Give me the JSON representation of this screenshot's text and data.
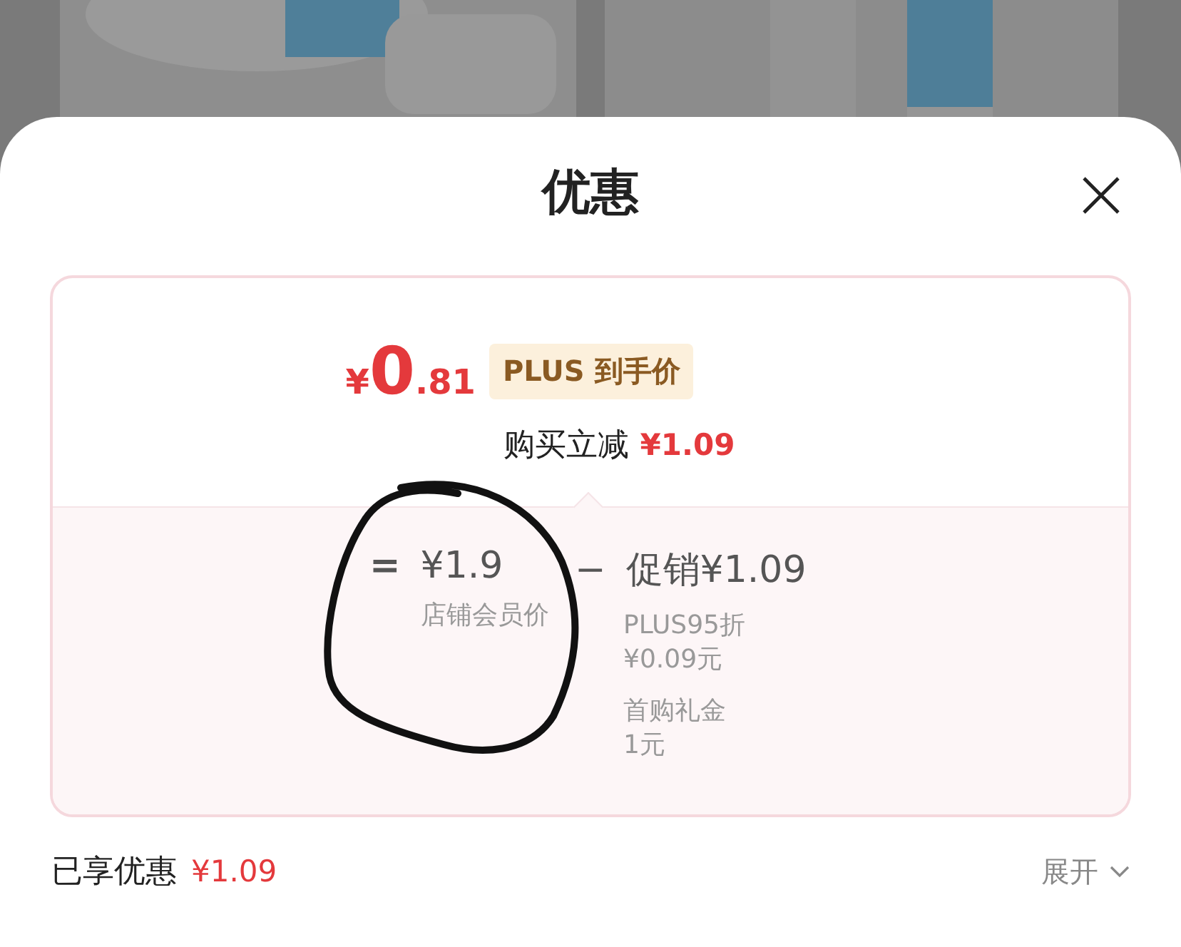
{
  "sheet": {
    "title": "优惠"
  },
  "summary": {
    "currency": "¥",
    "price_integer": "0",
    "price_decimal": ".81",
    "badge": "PLUS 到手价",
    "instant_label": "购买立减",
    "instant_amount": "¥1.09"
  },
  "breakdown": {
    "base": {
      "operator": "=",
      "amount": "¥1.9",
      "label": "店铺会员价"
    },
    "deductions": [
      {
        "operator": "−",
        "title": "促销¥1.09",
        "details": [
          {
            "lines": [
              "PLUS95折",
              "¥0.09元"
            ]
          },
          {
            "lines": [
              "首购礼金",
              "1元"
            ]
          }
        ]
      }
    ]
  },
  "footer": {
    "label": "已享优惠",
    "amount": "¥1.09",
    "toggle": "展开"
  }
}
